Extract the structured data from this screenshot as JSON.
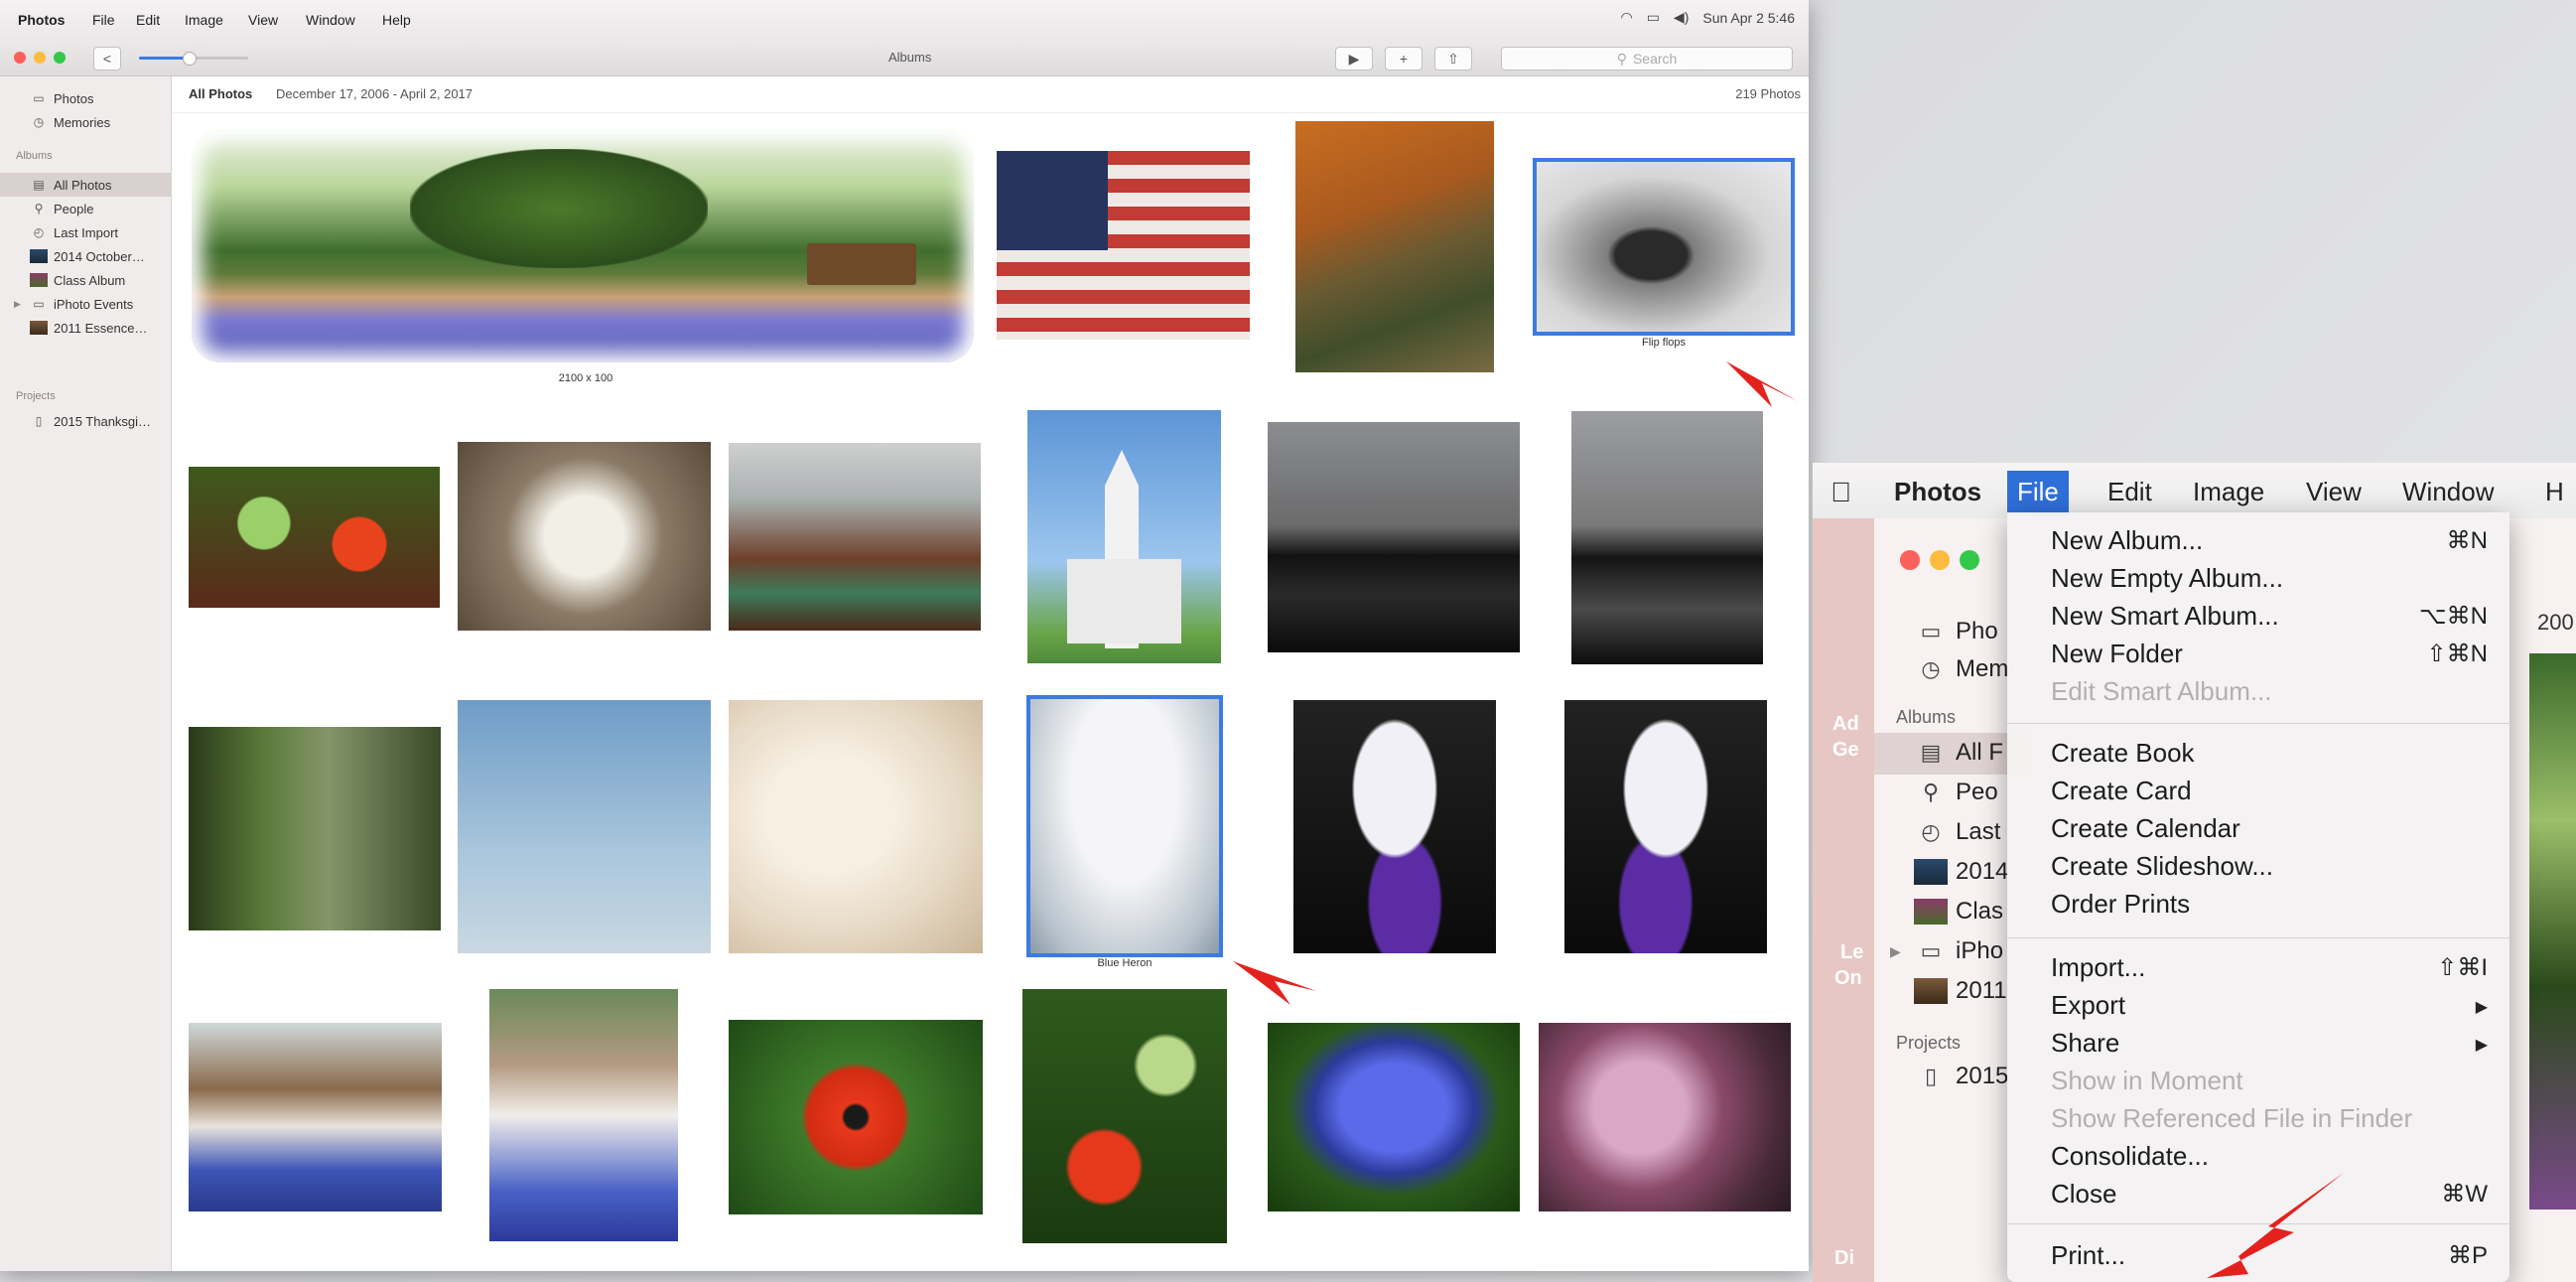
{
  "left_window": {
    "menubar": {
      "app": "Photos",
      "items": [
        "File",
        "Edit",
        "Image",
        "View",
        "Window",
        "Help"
      ],
      "clock": "Sun Apr 2 5:46"
    },
    "toolbar": {
      "title": "Albums",
      "search_placeholder": "Search",
      "back_symbol": "<",
      "play_symbol": "▶",
      "add_symbol": "+",
      "share_symbol": "⇧",
      "zoom_slider": 0.45
    },
    "sidebar": {
      "items_top": [
        {
          "label": "Photos",
          "icon": "photos-icon"
        },
        {
          "label": "Memories",
          "icon": "memories-icon"
        }
      ],
      "albums_header": "Albums",
      "albums": [
        {
          "label": "All Photos",
          "icon": "album-icon",
          "selected": true
        },
        {
          "label": "People",
          "icon": "people-icon"
        },
        {
          "label": "Last Import",
          "icon": "clock-icon"
        },
        {
          "label": "2014 October…",
          "icon": "album-thumb-icon"
        },
        {
          "label": "Class Album",
          "icon": "album-thumb-icon"
        },
        {
          "label": "iPhoto Events",
          "icon": "folder-icon"
        },
        {
          "label": "2011 Essence…",
          "icon": "album-thumb-icon"
        }
      ],
      "projects_header": "Projects",
      "projects": [
        {
          "label": "2015 Thanksgi…",
          "icon": "book-icon"
        }
      ]
    },
    "content_header": {
      "title": "All Photos",
      "date_range": "December 17, 2006 - April 2, 2017",
      "count": "219 Photos"
    },
    "captions": {
      "panorama": "2100 x 100",
      "flip_flops": "Flip flops",
      "blue_heron": "Blue Heron"
    }
  },
  "zoom_panel": {
    "menubar": {
      "apple": "",
      "app": "Photos",
      "items": [
        "File",
        "Edit",
        "Image",
        "View",
        "Window",
        "H"
      ]
    },
    "sidebar_labels": {
      "photos": "Pho",
      "memories": "Mem",
      "albums_header": "Albums",
      "all": "All F",
      "people": "Peo",
      "last": "Last",
      "y2014": "2014",
      "class": "Clas",
      "iphoto": "iPho",
      "y2011": "2011",
      "projects_header": "Projects",
      "y2015": "2015"
    },
    "edge_text": {
      "t200": "200",
      "ad": "Ad",
      "ge": "Ge",
      "le": "Le",
      "on": "On",
      "di": "Di"
    },
    "file_menu": [
      {
        "label": "New Album...",
        "shortcut": "⌘N"
      },
      {
        "label": "New Empty Album...",
        "shortcut": ""
      },
      {
        "label": "New Smart Album...",
        "shortcut": "⌥⌘N"
      },
      {
        "label": "New Folder",
        "shortcut": "⇧⌘N"
      },
      {
        "label": "Edit Smart Album...",
        "shortcut": "",
        "disabled": true
      },
      {
        "label": "Create Book",
        "shortcut": ""
      },
      {
        "label": "Create Card",
        "shortcut": ""
      },
      {
        "label": "Create Calendar",
        "shortcut": ""
      },
      {
        "label": "Create Slideshow...",
        "shortcut": ""
      },
      {
        "label": "Order Prints",
        "shortcut": ""
      },
      {
        "label": "Import...",
        "shortcut": "⇧⌘I"
      },
      {
        "label": "Export",
        "shortcut": "▶"
      },
      {
        "label": "Share",
        "shortcut": "▶"
      },
      {
        "label": "Show in Moment",
        "shortcut": "",
        "disabled": true
      },
      {
        "label": "Show Referenced File in Finder",
        "shortcut": "",
        "disabled": true
      },
      {
        "label": "Consolidate...",
        "shortcut": ""
      },
      {
        "label": "Close",
        "shortcut": "⌘W"
      },
      {
        "label": "Print...",
        "shortcut": "⌘P"
      }
    ]
  },
  "colors": {
    "selection_blue": "#3c7be0",
    "menu_highlight": "#2f6fd8",
    "arrow_red": "#e3221e",
    "sidebar_bg": "#f1ecec"
  }
}
